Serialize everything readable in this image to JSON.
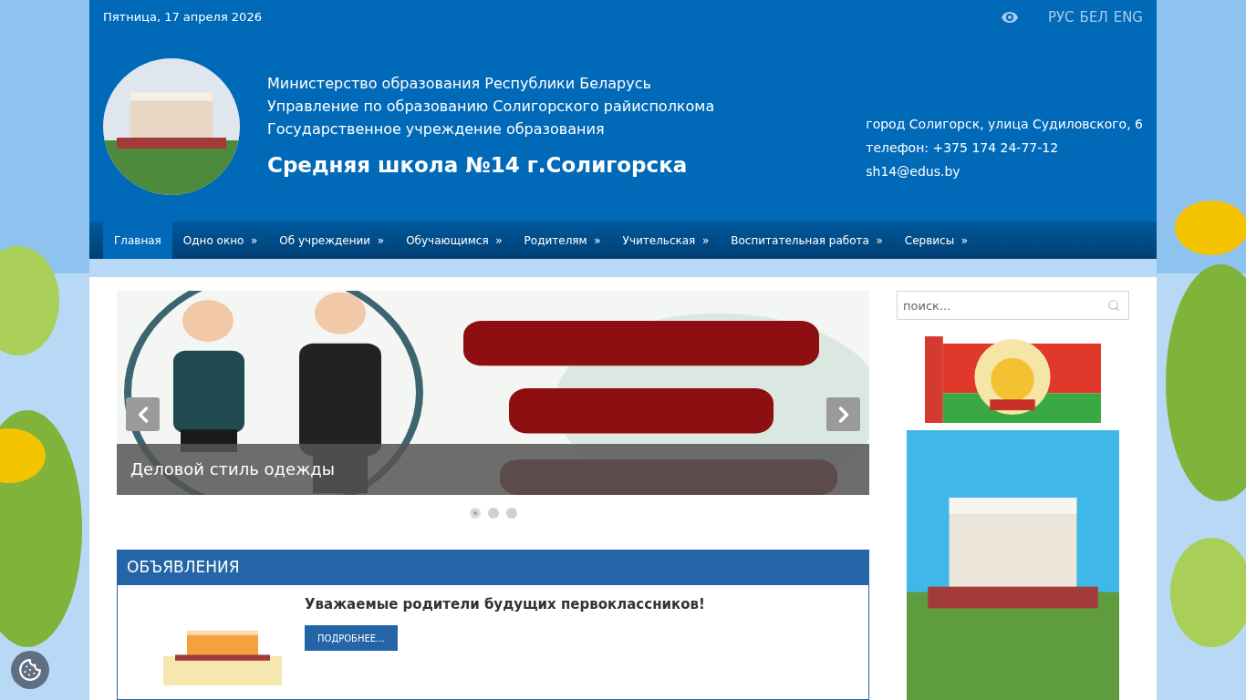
{
  "top_bar": {
    "date": "Пятница, 17 апреля 2026",
    "languages": [
      "РУС",
      "БЕЛ",
      "ENG"
    ]
  },
  "header": {
    "lines": [
      "Министерство образования Республики Беларусь",
      "Управление по образованию Солигорского райисполкома",
      "Государственное учреждение образования"
    ],
    "school_name": "Средняя школа №14 г.Солигорска",
    "contacts": [
      "город Солигорск, улица Судиловского, 6",
      "телефон: +375 174 24-77-12",
      "sh14@edus.by"
    ]
  },
  "nav": [
    {
      "label": "Главная",
      "submenu": false,
      "selected": true
    },
    {
      "label": "Одно окно",
      "submenu": true,
      "selected": false
    },
    {
      "label": "Об учреждении",
      "submenu": true,
      "selected": false
    },
    {
      "label": "Обучающимся",
      "submenu": true,
      "selected": false
    },
    {
      "label": "Родителям",
      "submenu": true,
      "selected": false
    },
    {
      "label": "Учительская",
      "submenu": true,
      "selected": false
    },
    {
      "label": "Воспитательная работа",
      "submenu": true,
      "selected": false
    },
    {
      "label": "Сервисы",
      "submenu": true,
      "selected": false
    }
  ],
  "nav_arrow": "»",
  "slider": {
    "caption": "Деловой стиль одежды",
    "dots": [
      {
        "selected": true
      },
      {
        "selected": false
      },
      {
        "selected": false
      }
    ]
  },
  "announcements": {
    "title": "ОБЪЯВЛЕНИЯ",
    "items": [
      {
        "title": "Уважаемые родители будущих первоклассников!",
        "button": "ПОДРОБНЕЕ..."
      }
    ]
  },
  "search": {
    "placeholder": "поиск..."
  }
}
